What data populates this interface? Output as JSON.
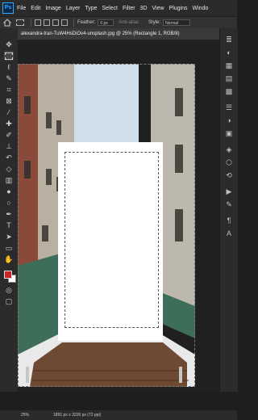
{
  "menubar": {
    "app_icon": "Ps",
    "items": [
      "File",
      "Edit",
      "Image",
      "Layer",
      "Type",
      "Select",
      "Filter",
      "3D",
      "View",
      "Plugins",
      "Windo"
    ]
  },
  "options": {
    "feather_label": "Feather:",
    "feather_value": "0 px",
    "anti_alias_label": "Anti-alias",
    "style_label": "Style:",
    "style_value": "Normal"
  },
  "document": {
    "tab_title": "alexandra-tran-TuW4HsDiOv4-unsplash.jpg @ 25% (Rectangle 1, RGB/8)"
  },
  "status": {
    "zoom": "25%",
    "size": "1891 px x 3226 px (72 ppi)"
  },
  "colors": {
    "foreground": "#c3272b",
    "background": "#ffffff",
    "accent": "#31a8ff"
  },
  "tools": [
    "move-icon",
    "marquee-icon",
    "lasso-icon",
    "quick-select-icon",
    "crop-icon",
    "frame-icon",
    "eyedropper-icon",
    "healing-icon",
    "brush-icon",
    "clone-stamp-icon",
    "history-brush-icon",
    "eraser-icon",
    "gradient-icon",
    "blur-icon",
    "dodge-icon",
    "pen-icon",
    "type-icon",
    "path-select-icon",
    "rectangle-icon",
    "hand-icon",
    "zoom-icon",
    "edit-toolbar-icon"
  ],
  "right_panel": [
    "layers-icon",
    "color-icon",
    "swatches-icon",
    "gradients-icon",
    "patterns-icon",
    "properties-icon",
    "adjustments-icon",
    "libraries-icon",
    "channels-icon",
    "paths-icon",
    "history-icon",
    "actions-icon",
    "brushes-icon",
    "paragraph-icon",
    "character-icon"
  ]
}
